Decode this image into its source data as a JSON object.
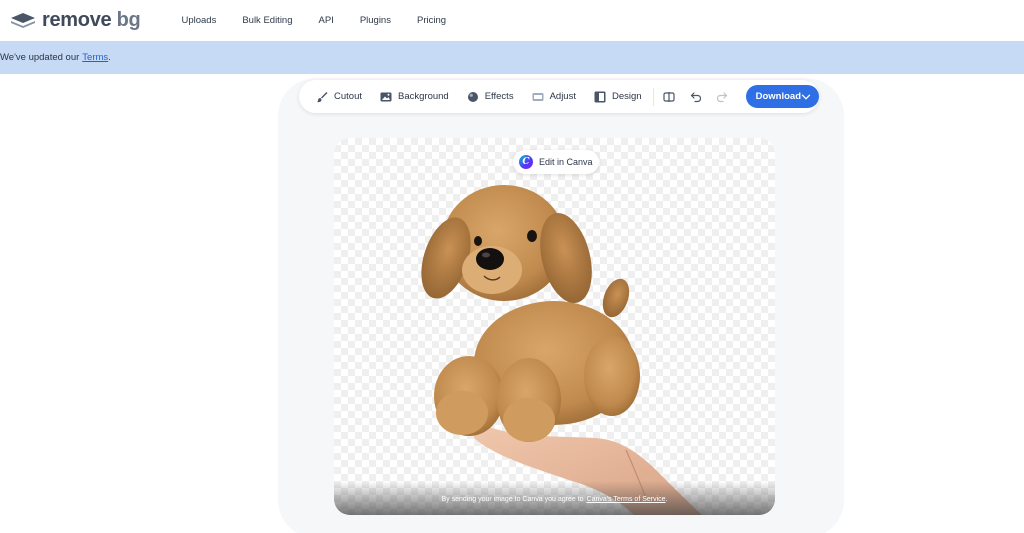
{
  "brand": {
    "name_part1": "remove",
    "name_part2": "bg",
    "logo_icon": "layers-icon"
  },
  "nav": {
    "links": [
      {
        "label": "Uploads"
      },
      {
        "label": "Bulk Editing"
      },
      {
        "label": "API"
      },
      {
        "label": "Plugins"
      },
      {
        "label": "Pricing"
      }
    ]
  },
  "banner": {
    "text": "We've updated our",
    "link": "Terms",
    "suffix": "."
  },
  "toolbar": {
    "tools": [
      {
        "label": "Cutout",
        "icon": "brush-icon"
      },
      {
        "label": "Background",
        "icon": "image-icon"
      },
      {
        "label": "Effects",
        "icon": "blur-icon"
      },
      {
        "label": "Adjust",
        "icon": "adjust-icon"
      },
      {
        "label": "Design",
        "icon": "design-icon"
      }
    ],
    "download_label": "Download",
    "accent": "#2e6fe5"
  },
  "canvas": {
    "edit_in_canva": "Edit in Canva",
    "footer_text": "By sending your image to Canva you agree to",
    "footer_link": "Canva's Terms of Service",
    "footer_suffix": "."
  },
  "colors": {
    "banner_bg": "#c6daf6",
    "link": "#1a64d6"
  }
}
